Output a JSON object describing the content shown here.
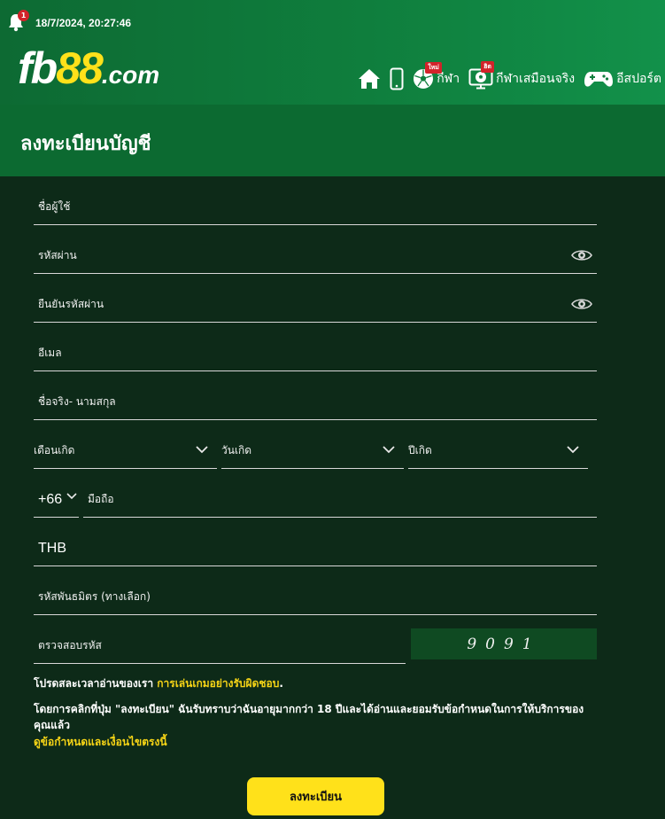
{
  "header": {
    "notification_count": "1",
    "datetime": "18/7/2024, 20:27:46",
    "logo": {
      "part1": "fb",
      "part2": "88",
      "part3": ".com"
    },
    "nav": [
      {
        "icon": "home-icon",
        "label": ""
      },
      {
        "icon": "mobile-icon",
        "label": ""
      },
      {
        "icon": "soccer-ball-icon",
        "label": "กีฬา",
        "tag": "ใหม่"
      },
      {
        "icon": "virtual-sports-icon",
        "label": "กีฬาเสมือนจริง",
        "tag": "ฮิต"
      },
      {
        "icon": "gamepad-icon",
        "label": "อีสปอร์ต"
      }
    ]
  },
  "page_title": "ลงทะเบียนบัญชี",
  "form": {
    "username_placeholder": "ชื่อผู้ใช้",
    "password_placeholder": "รหัสผ่าน",
    "confirm_password_placeholder": "ยืนยันรหัสผ่าน",
    "email_placeholder": "อีเมล",
    "fullname_placeholder": "ชื่อจริง- นามสกุล",
    "birth_month_placeholder": "เดือนเกิด",
    "birth_day_placeholder": "วันเกิด",
    "birth_year_placeholder": "ปีเกิด",
    "country_code": "+66",
    "phone_placeholder": "มือถือ",
    "currency": "THB",
    "referral_placeholder": "รหัสพันธมิตร (ทางเลือก)",
    "captcha_placeholder": "ตรวจสอบรหัส",
    "captcha_code": "9091"
  },
  "notes": {
    "responsible_prefix": "โปรดสละเวลาอ่านของเรา ",
    "responsible_link": "การเล่นเกมอย่างรับผิดชอบ",
    "responsible_suffix": ".",
    "agreement": "โดยการคลิกที่ปุ่ม \"ลงทะเบียน\" ฉันรับทราบว่าฉันอายุมากกว่า 18 ปีและได้อ่านและยอมรับข้อกำหนดในการให้บริการของคุณแล้ว",
    "terms_link": "ดูข้อกำหนดและเงื่อนไขตรงนี้"
  },
  "submit_label": "ลงทะเบียน",
  "colors": {
    "accent_yellow": "#ffe11a",
    "header_green": "#0f7e3d",
    "background": "#0d2a18",
    "badge_red": "#d2232a"
  }
}
